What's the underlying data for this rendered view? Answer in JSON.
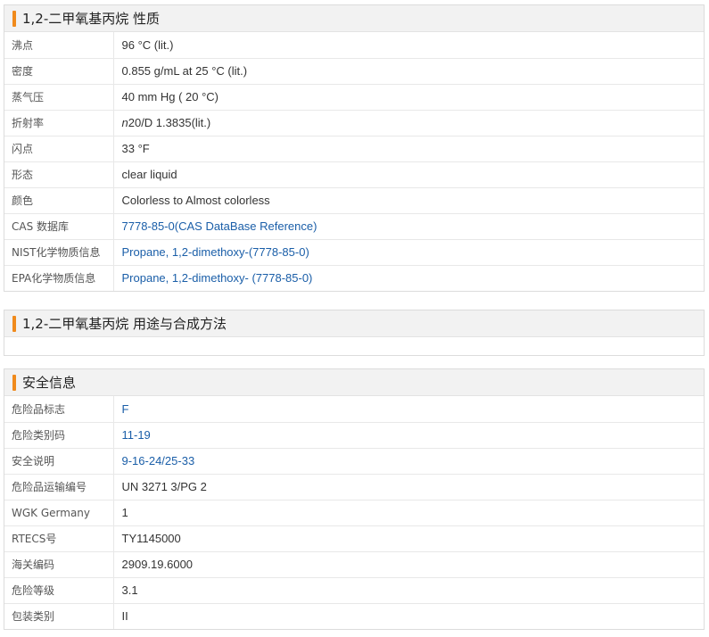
{
  "properties": {
    "title": "1,2-二甲氧基丙烷 性质",
    "rows": [
      {
        "label": "沸点",
        "value": "96 °C (lit.)",
        "link": false
      },
      {
        "label": "密度",
        "value": "0.855 g/mL at 25 °C (lit.)",
        "link": false
      },
      {
        "label": "蒸气压",
        "value": "40 mm Hg ( 20 °C)",
        "link": false
      },
      {
        "label": "折射率",
        "value_italic": "n",
        "value": "20/D 1.3835(lit.)",
        "link": false
      },
      {
        "label": "闪点",
        "value": "33 °F",
        "link": false
      },
      {
        "label": "形态",
        "value": "clear liquid",
        "link": false
      },
      {
        "label": "颜色",
        "value": "Colorless to Almost colorless",
        "link": false
      },
      {
        "label": "CAS 数据库",
        "value": "7778-85-0(CAS DataBase Reference)",
        "link": true
      },
      {
        "label": "NIST化学物质信息",
        "value": "Propane, 1,2-dimethoxy-(7778-85-0)",
        "link": true
      },
      {
        "label": "EPA化学物质信息",
        "value": "Propane, 1,2-dimethoxy- (7778-85-0)",
        "link": true
      }
    ]
  },
  "uses": {
    "title": "1,2-二甲氧基丙烷 用途与合成方法"
  },
  "safety": {
    "title": "安全信息",
    "rows": [
      {
        "label": "危险品标志",
        "value": "F",
        "link": true
      },
      {
        "label": "危险类别码",
        "value": "11-19",
        "link": true
      },
      {
        "label": "安全说明",
        "value": "9-16-24/25-33",
        "link": true
      },
      {
        "label": "危险品运输编号",
        "value": "UN 3271 3/PG 2",
        "link": false
      },
      {
        "label": "WGK Germany",
        "value": "1",
        "link": false
      },
      {
        "label": "RTECS号",
        "value": "TY1145000",
        "link": false
      },
      {
        "label": "海关编码",
        "value": "2909.19.6000",
        "link": false
      },
      {
        "label": "危险等级",
        "value": "3.1",
        "link": false
      },
      {
        "label": "包装类别",
        "value": "II",
        "link": false
      }
    ]
  },
  "colors": {
    "accent_bar": "#f08a1c",
    "link": "#1a5ea8",
    "header_bg": "#f2f2f2"
  }
}
